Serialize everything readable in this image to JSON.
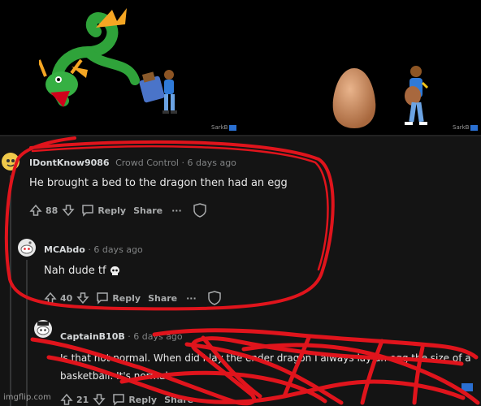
{
  "meme": {
    "watermark_left": "SarkB",
    "watermark_right": "SarkB"
  },
  "comments": [
    {
      "username": "IDontKnow9086",
      "flair": "Crowd Control",
      "time": "6 days ago",
      "body": "He brought a bed to the dragon then had an egg",
      "votes": "88",
      "reply": "Reply",
      "share": "Share",
      "more": "···"
    },
    {
      "username": "MCAbdo",
      "time": "6 days ago",
      "body": "Nah dude tf",
      "votes": "40",
      "reply": "Reply",
      "share": "Share",
      "more": "···"
    },
    {
      "username": "CaptainB10B",
      "time": "6 days ago",
      "body_line1": "Is that not normal. When did I lay the ender dragon I always lay an egg the size of a",
      "body_line2": "basketball. It's normal",
      "votes": "21",
      "reply": "Reply",
      "share": "Share"
    }
  ],
  "footer": {
    "credit": "imgflip.com"
  },
  "colors": {
    "scribble": "#e0141c",
    "background": "#141414",
    "text": "#d7dadc"
  }
}
